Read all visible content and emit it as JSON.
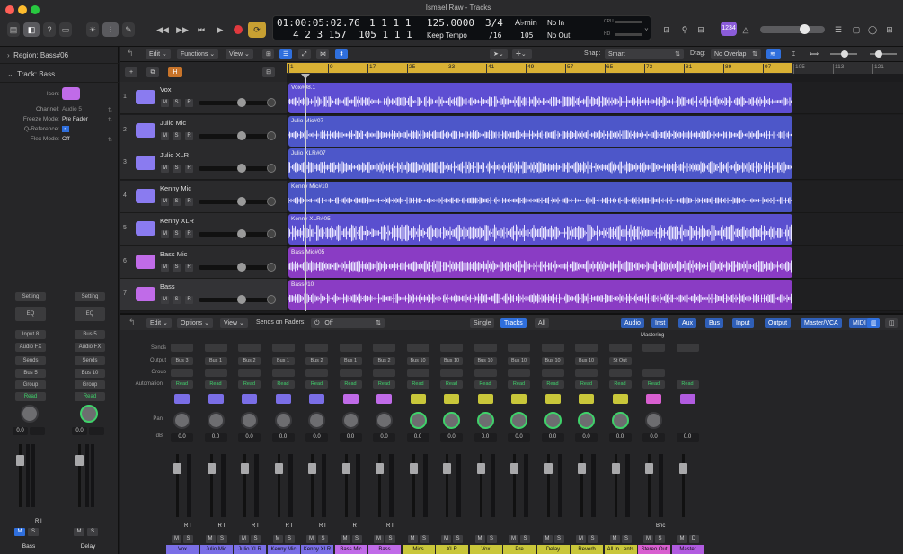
{
  "window": {
    "title": "Ismael Raw - Tracks"
  },
  "lcd": {
    "time_position": "01:00:05:02.76",
    "bar_position": "4 2 3 157",
    "bar_a": "1 1 1 1",
    "bar_b": "105 1 1 1",
    "tempo": "125.0000",
    "tempo_mode": "Keep Tempo",
    "time_sig": "3/4",
    "division": "/16",
    "key": "A♭min",
    "key_num": "105",
    "midi_in": "No In",
    "midi_out": "No Out",
    "cpu_label": "CPU",
    "hd_label": "HD"
  },
  "toolbar": {
    "badge": "1234"
  },
  "inspector": {
    "region_label": "Region: Bass#06",
    "track_label": "Track: Bass",
    "params": [
      {
        "label": "Icon:",
        "value": ""
      },
      {
        "label": "Channel:",
        "value": "Audio 5"
      },
      {
        "label": "Freeze Mode:",
        "value": "Pre Fader"
      },
      {
        "label": "Q-Reference:",
        "value": "✓"
      },
      {
        "label": "Flex Mode:",
        "value": "Off"
      }
    ],
    "strips": [
      {
        "setting": "Setting",
        "eq": "EQ",
        "input": "Input 8",
        "fx": "Audio FX",
        "sends": "Sends",
        "output": "Bus 5",
        "group": "Group",
        "auto": "Read",
        "db": "0.0",
        "name": "Bass",
        "mute": "M",
        "solo": "S",
        "ri": "R I"
      },
      {
        "setting": "Setting",
        "eq": "EQ",
        "input": "Bus 5",
        "fx": "Audio FX",
        "sends": "Sends",
        "output": "Bus 10",
        "group": "Group",
        "auto": "Read",
        "db": "0.0",
        "name": "Delay",
        "mute": "M",
        "solo": "S",
        "ri": ""
      }
    ]
  },
  "tracks_toolbar": {
    "edit": "Edit",
    "functions": "Functions",
    "view": "View",
    "snap_label": "Snap:",
    "snap_value": "Smart",
    "drag_label": "Drag:",
    "drag_value": "No Overlap"
  },
  "ruler": {
    "ticks": [
      "1",
      "9",
      "17",
      "25",
      "33",
      "41",
      "49",
      "57",
      "65",
      "73",
      "81",
      "89",
      "97",
      "105",
      "113",
      "121"
    ]
  },
  "tracks": [
    {
      "num": "1",
      "name": "Vox",
      "region": "Vox#08.1",
      "color": "#5e4ed2",
      "icon_color": "#8a7bf0",
      "mute": "M",
      "solo": "S",
      "rec": "R"
    },
    {
      "num": "2",
      "name": "Julio Mic",
      "region": "Julio Mic#07",
      "color": "#4d57c9",
      "icon_color": "#8a7bf0",
      "mute": "M",
      "solo": "S",
      "rec": "R"
    },
    {
      "num": "3",
      "name": "Julio XLR",
      "region": "Julio XLR#07",
      "color": "#4d57c9",
      "icon_color": "#8a7bf0",
      "mute": "M",
      "solo": "S",
      "rec": "R"
    },
    {
      "num": "4",
      "name": "Kenny Mic",
      "region": "Kenny Mic#10",
      "color": "#4a55c4",
      "icon_color": "#8a7bf0",
      "mute": "M",
      "solo": "S",
      "rec": "R"
    },
    {
      "num": "5",
      "name": "Kenny XLR",
      "region": "Kenny XLR#05",
      "color": "#5a4fcf",
      "icon_color": "#8a7bf0",
      "mute": "M",
      "solo": "S",
      "rec": "R"
    },
    {
      "num": "6",
      "name": "Bass Mic",
      "region": "Bass Mic#05",
      "color": "#8a3cc4",
      "icon_color": "#c06be8",
      "mute": "M",
      "solo": "S",
      "rec": "R"
    },
    {
      "num": "7",
      "name": "Bass",
      "region": "Bass#10",
      "color": "#8a3cc4",
      "icon_color": "#c06be8",
      "mute": "M",
      "solo": "S",
      "rec": "R"
    }
  ],
  "mixer_toolbar": {
    "edit": "Edit",
    "options": "Options",
    "view": "View",
    "sends_label": "Sends on Faders:",
    "sends_value": "Off",
    "tabs": [
      "Single",
      "Tracks",
      "All"
    ],
    "filters": [
      "Audio",
      "Inst",
      "Aux",
      "Bus",
      "Input",
      "Output",
      "Master/VCA",
      "MIDI"
    ]
  },
  "mixer_labels": {
    "sends": "Sends",
    "output": "Output",
    "group": "Group",
    "automation": "Automation",
    "pan": "Pan",
    "db": "dB",
    "mastering": "Mastering"
  },
  "channels": [
    {
      "name": "Vox",
      "output": "Bus 3",
      "auto": "Read",
      "db": "0.0",
      "color": "#7a6ee6",
      "type": "audio",
      "mute": "M",
      "solo": "S",
      "ri": "R I"
    },
    {
      "name": "Julio Mic",
      "output": "Bus 1",
      "auto": "Read",
      "db": "0.0",
      "color": "#7a6ee6",
      "type": "audio",
      "mute": "M",
      "solo": "S",
      "ri": "R I"
    },
    {
      "name": "Julio XLR",
      "output": "Bus 2",
      "auto": "Read",
      "db": "0.0",
      "color": "#7a6ee6",
      "type": "audio",
      "mute": "M",
      "solo": "S",
      "ri": "R I"
    },
    {
      "name": "Kenny Mic",
      "output": "Bus 1",
      "auto": "Read",
      "db": "0.0",
      "color": "#7a6ee6",
      "type": "audio",
      "mute": "M",
      "solo": "S",
      "ri": "R I"
    },
    {
      "name": "Kenny XLR",
      "output": "Bus 2",
      "auto": "Read",
      "db": "0.0",
      "color": "#7a6ee6",
      "type": "audio",
      "mute": "M",
      "solo": "S",
      "ri": "R I"
    },
    {
      "name": "Bass Mic",
      "output": "Bus 1",
      "auto": "Read",
      "db": "0.0",
      "color": "#c06be8",
      "type": "audio",
      "mute": "M",
      "solo": "S",
      "ri": "R I"
    },
    {
      "name": "Bass",
      "output": "Bus 2",
      "auto": "Read",
      "db": "0.0",
      "color": "#c06be8",
      "type": "audio",
      "mute": "M",
      "solo": "S",
      "ri": "R I"
    },
    {
      "name": "Mics",
      "output": "Bus 10",
      "auto": "Read",
      "db": "0.0",
      "color": "#c9c73a",
      "type": "aux",
      "mute": "M",
      "solo": "S",
      "ri": ""
    },
    {
      "name": "XLR",
      "output": "Bus 10",
      "auto": "Read",
      "db": "0.0",
      "color": "#c9c73a",
      "type": "aux",
      "mute": "M",
      "solo": "S",
      "ri": ""
    },
    {
      "name": "Vox",
      "output": "Bus 10",
      "auto": "Read",
      "db": "0.0",
      "color": "#c9c73a",
      "type": "aux",
      "mute": "M",
      "solo": "S",
      "ri": ""
    },
    {
      "name": "Pre",
      "output": "Bus 10",
      "auto": "Read",
      "db": "0.0",
      "color": "#c9c73a",
      "type": "aux",
      "mute": "M",
      "solo": "S",
      "ri": ""
    },
    {
      "name": "Delay",
      "output": "Bus 10",
      "auto": "Read",
      "db": "0.0",
      "color": "#c9c73a",
      "type": "aux",
      "mute": "M",
      "solo": "S",
      "ri": ""
    },
    {
      "name": "Reverb",
      "output": "Bus 10",
      "auto": "Read",
      "db": "0.0",
      "color": "#c9c73a",
      "type": "aux",
      "mute": "M",
      "solo": "S",
      "ri": ""
    },
    {
      "name": "All In...ents",
      "output": "St Out",
      "auto": "Read",
      "db": "0.0",
      "color": "#c9c73a",
      "type": "aux",
      "mute": "M",
      "solo": "S",
      "ri": ""
    },
    {
      "name": "Stereo Out",
      "output": "",
      "auto": "Read",
      "db": "0.0",
      "color": "#d85fd0",
      "type": "out",
      "mute": "M",
      "solo": "S",
      "ri": "Bnc"
    },
    {
      "name": "Master",
      "output": "",
      "auto": "Read",
      "db": "0.0",
      "color": "#b15be0",
      "type": "master",
      "mute": "M",
      "solo": "D",
      "ri": ""
    }
  ]
}
